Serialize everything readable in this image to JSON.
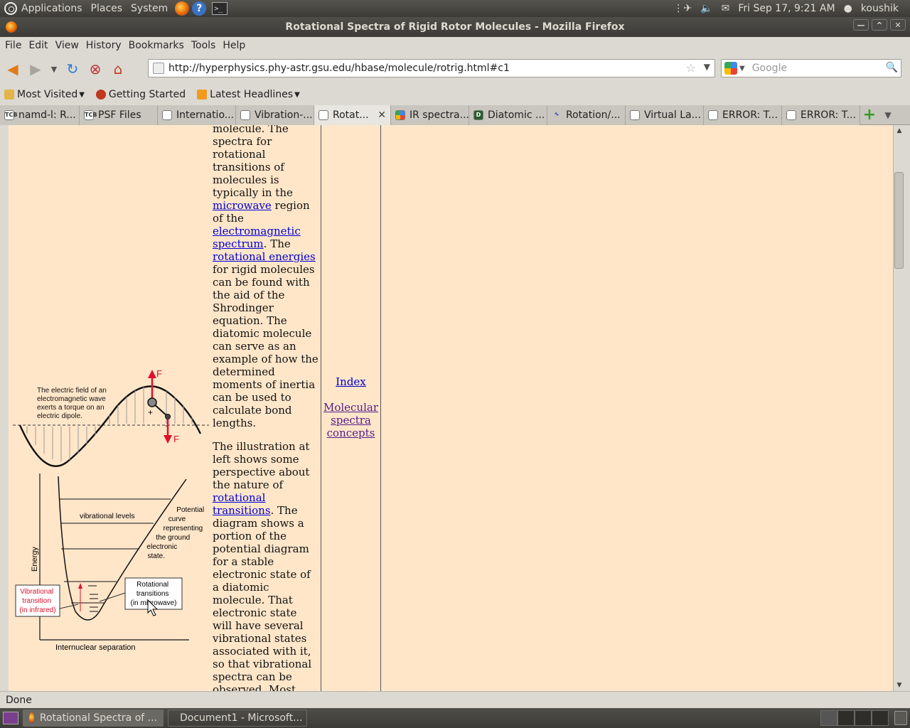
{
  "top_panel": {
    "menus": [
      "Applications",
      "Places",
      "System"
    ],
    "clock": "Fri Sep 17,  9:21 AM",
    "user": "koushik"
  },
  "window": {
    "title": "Rotational Spectra of Rigid Rotor Molecules - Mozilla Firefox"
  },
  "menubar": [
    "File",
    "Edit",
    "View",
    "History",
    "Bookmarks",
    "Tools",
    "Help"
  ],
  "navbar": {
    "url": "http://hyperphysics.phy-astr.gsu.edu/hbase/molecule/rotrig.html#c1",
    "search_placeholder": "Google"
  },
  "bookmarks": [
    "Most Visited",
    "Getting Started",
    "Latest Headlines"
  ],
  "tabs": [
    {
      "label": "namd-l: R...",
      "icon": "TCB"
    },
    {
      "label": "PSF Files",
      "icon": "TCB"
    },
    {
      "label": "Internatio...",
      "icon": ""
    },
    {
      "label": "Vibration-...",
      "icon": ""
    },
    {
      "label": "Rotat...",
      "icon": ""
    },
    {
      "label": "IR spectra...",
      "icon": ""
    },
    {
      "label": "Diatomic ...",
      "icon": "D"
    },
    {
      "label": "Rotation/...",
      "icon": ""
    },
    {
      "label": "Virtual La...",
      "icon": ""
    },
    {
      "label": "ERROR: T...",
      "icon": ""
    },
    {
      "label": "ERROR: T...",
      "icon": ""
    }
  ],
  "article": {
    "p1_a": "molecule. The spectra for rotational transitions of molecules is typically in the ",
    "link_microwave": "microwave",
    "p1_b": " region of the ",
    "link_em": "electromagnetic spectrum",
    "p1_c": ". The ",
    "link_rot_energies": "rotational energies",
    "p1_d": " for rigid molecules can be found with the aid of the Shrodinger equation. The diatomic molecule can serve as an example of how the determined moments of inertia can be used to calculate bond lengths.",
    "p2_a": "The illustration at left shows some perspective about the nature of ",
    "link_rot_trans": "rotational transitions",
    "p2_b": ". The diagram shows a portion of the potential diagram for a stable electronic state of a diatomic molecule. That electronic state will have several vibrational states associated with it, so that vibrational spectra can be observed. Most"
  },
  "figure": {
    "wave_caption": [
      "The electric field of an",
      "electromagnetic wave",
      "exerts a torque on an",
      "electric dipole."
    ],
    "force_label": "F",
    "plus": "+",
    "minus": "-",
    "vib_levels": "vibrational levels",
    "potential": [
      "Potential",
      "curve",
      "representing",
      "the ground",
      "electronic",
      "state."
    ],
    "energy": "Energy",
    "vib_transition": [
      "Vibrational",
      "transition",
      "(in infrared)"
    ],
    "rot_transitions": [
      "Rotational",
      "transitions",
      "(in microwave)"
    ],
    "xaxis": "Internuclear separation"
  },
  "sidenav": {
    "index": "Index",
    "molecular": "Molecular spectra concepts"
  },
  "status": "Done",
  "taskbar": {
    "items": [
      "Rotational Spectra of ...",
      "Document1 - Microsoft..."
    ]
  },
  "colors": {
    "page_bg": "#ffe6c9",
    "link": "#0000d6",
    "visited": "#551a8b",
    "red": "#e0102a"
  }
}
